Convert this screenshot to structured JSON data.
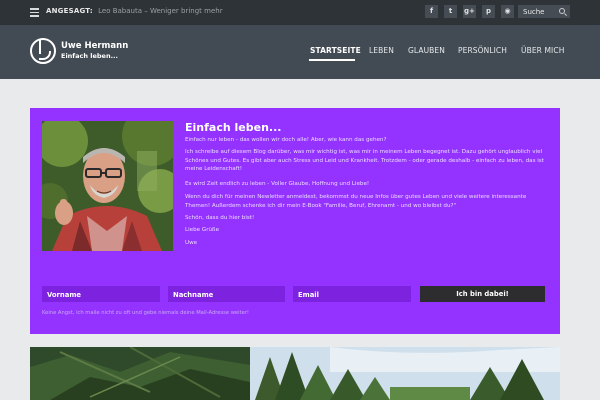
{
  "topbar": {
    "announce_label": "ANGESAGT:",
    "announce_text": "Leo Babauta – Weniger bringt mehr",
    "social": [
      {
        "icon": "facebook-icon",
        "glyph": "f"
      },
      {
        "icon": "twitter-icon",
        "glyph": "t"
      },
      {
        "icon": "google-plus-icon",
        "glyph": "g+"
      },
      {
        "icon": "pinterest-icon",
        "glyph": "p"
      },
      {
        "icon": "rss-icon",
        "glyph": "◉"
      }
    ],
    "search_placeholder": "Suche"
  },
  "header": {
    "brand_name": "Uwe Hermann",
    "brand_tagline": "Einfach leben...",
    "nav": [
      "STARTSEITE",
      "LEBEN",
      "GLAUBEN",
      "PERSÖNLICH",
      "ÜBER MICH"
    ],
    "active_nav": "STARTSEITE"
  },
  "hero": {
    "title": "Einfach leben...",
    "paragraphs": [
      "Einfach nur leben - das wollen wir doch alle! Aber, wie kann das gehen?",
      "Ich schreibe auf diesem Blog darüber, was mir wichtig ist, was mir in meinem Leben begegnet ist. Dazu gehört unglaublich viel Schönes und Gutes. Es gibt aber auch Stress und Leid und Krankheit. Trotzdem - oder gerade deshalb - einfach zu leben, das ist meine Leidenschaft!",
      "Es wird Zeit endlich zu leben - Voller Glaube, Hoffnung und Liebe!",
      "Wenn du dich für meinen Newletter anmeldest, bekommst du neue Infos über gutes Leben und viele weitere interessante Themen! Außerdem schenke ich dir mein E-Book \"Familie, Beruf, Ehrenamt - und wo bleibst du?\"",
      "Schön, dass du hier bist!",
      "Liebe Grüße",
      "Uwe"
    ],
    "form": {
      "first_name_placeholder": "Vorname",
      "last_name_placeholder": "Nachname",
      "email_placeholder": "Email",
      "submit_label": "Ich bin dabei!"
    },
    "privacy_note": "Keine Angst, ich maile nicht zu oft und gebe niemals deine Mail-Adresse weiter!"
  },
  "colors": {
    "hero_bg": "#9433ff",
    "topbar_bg": "#2e3338",
    "header_bg": "#424b54",
    "page_bg": "#e9eaec"
  }
}
